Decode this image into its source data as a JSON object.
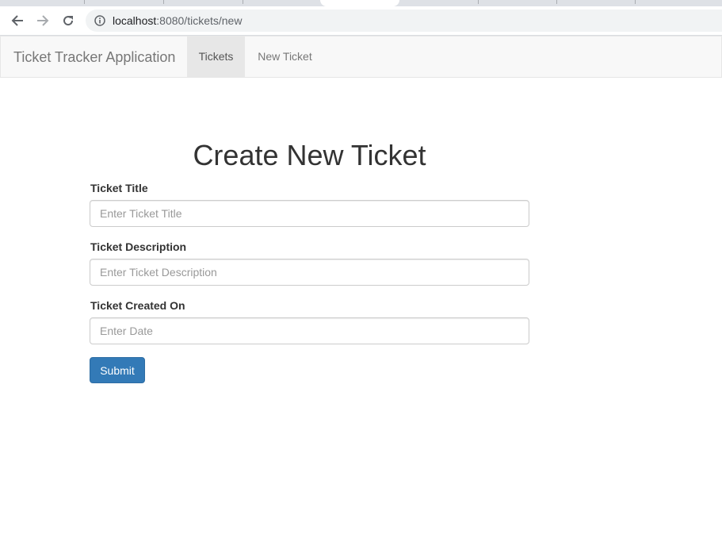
{
  "browser": {
    "url_host": "localhost",
    "url_path": ":8080/tickets/new",
    "icons": {
      "back": "arrow-left-icon",
      "forward": "arrow-right-icon",
      "reload": "reload-icon",
      "site_info": "info-icon"
    }
  },
  "navbar": {
    "brand": "Ticket Tracker Application",
    "links": [
      {
        "label": "Tickets",
        "active": true
      },
      {
        "label": "New Ticket",
        "active": false
      }
    ]
  },
  "form": {
    "title": "Create New Ticket",
    "fields": [
      {
        "label": "Ticket Title",
        "placeholder": "Enter Ticket Title",
        "value": ""
      },
      {
        "label": "Ticket Description",
        "placeholder": "Enter Ticket Description",
        "value": ""
      },
      {
        "label": "Ticket Created On",
        "placeholder": "Enter Date",
        "value": ""
      }
    ],
    "submit_label": "Submit"
  },
  "colors": {
    "primary_button": "#337ab7",
    "navbar_bg": "#f8f8f8",
    "active_nav_bg": "#e7e7e7"
  }
}
